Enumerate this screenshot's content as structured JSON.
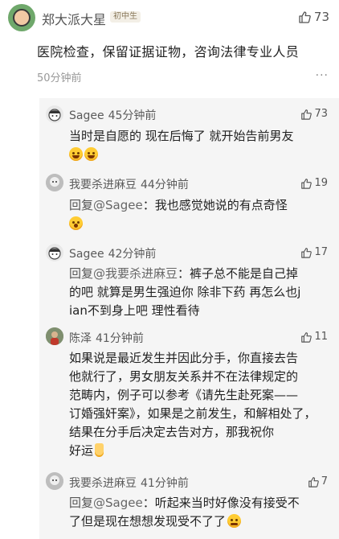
{
  "post": {
    "username": "郑大派大星",
    "badge": "初中生",
    "like_count": "73",
    "text": "医院检查，保留证据证物，咨询法律专业人员",
    "time": "50分钟前",
    "more_icon": "more-dots-icon"
  },
  "replies": [
    {
      "username": "Sagee",
      "time": "45分钟前",
      "like_count": "73",
      "lines": [
        "当时是自愿的 现在后悔了 就开始告前男友"
      ],
      "emojis": [
        "laugh-tears-emoji",
        "laugh-tears-emoji"
      ]
    },
    {
      "username": "我要杀进麻豆",
      "time": "44分钟前",
      "like_count": "19",
      "reply_prefix": "回复",
      "reply_to": "@Sagee",
      "lines": [
        "：我也感觉她说的有点奇怪"
      ],
      "emojis": [
        "surprised-emoji"
      ]
    },
    {
      "username": "Sagee",
      "time": "42分钟前",
      "like_count": "17",
      "reply_prefix": "回复",
      "reply_to": "@我要杀进麻豆",
      "lines": [
        "：裤子总不能是自己掉",
        "的吧 就算是男生强迫你 除非下药 再怎么也j",
        "ian不到身上吧 理性看待"
      ]
    },
    {
      "username": "陈泽",
      "time": "41分钟前",
      "like_count": "11",
      "lines": [
        "如果说是最近发生并因此分手，你直接去告",
        "他就行了，男女朋友关系并不在法律规定的",
        "范畴内，例子可以参考《请先生赴死案——",
        "订婚强奸案》，如果是之前发生，和解相处了，",
        "结果在分手后决定去告对方，那我祝你",
        "好运"
      ],
      "emojis": [
        "victory-hand-emoji"
      ]
    },
    {
      "username": "我要杀进麻豆",
      "time": "41分钟前",
      "like_count": "7",
      "reply_prefix": "回复",
      "reply_to": "@Sagee",
      "lines": [
        "：听起来当时好像没有接受不",
        "了但是现在想想发现受不了了"
      ],
      "emojis": [
        "dizzy-face-emoji"
      ]
    }
  ]
}
